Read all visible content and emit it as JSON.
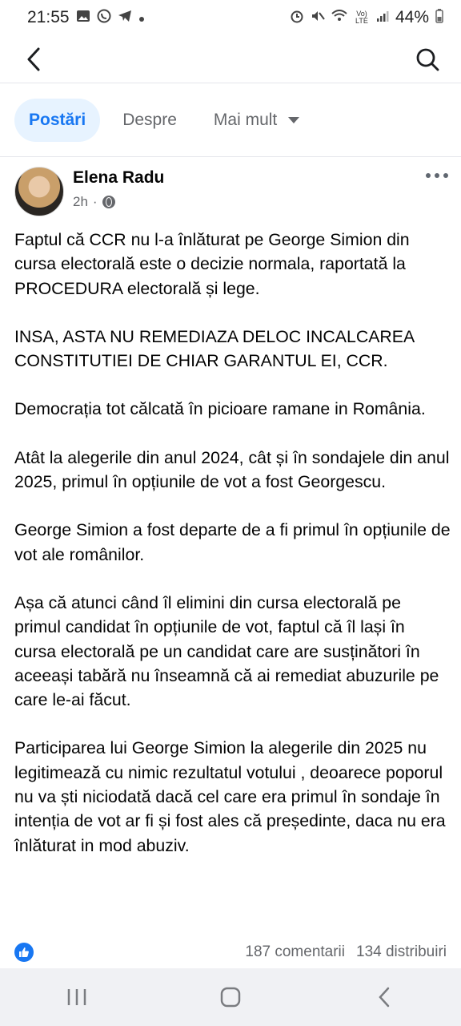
{
  "status_bar": {
    "time": "21:55",
    "battery": "44%",
    "network": "Vo) LTE"
  },
  "header": {
    "back_icon": "chevron-left-icon",
    "search_icon": "search-icon"
  },
  "tabs": [
    {
      "label": "Postări",
      "active": true
    },
    {
      "label": "Despre",
      "active": false
    },
    {
      "label": "Mai mult",
      "active": false
    }
  ],
  "post": {
    "author": "Elena Radu",
    "time": "2h",
    "separator": "·",
    "paragraphs": [
      "Faptul că CCR nu l-a înlăturat pe George Simion din cursa electorală este o decizie normala, raportată la PROCEDURA electorală și lege.",
      "INSA, ASTA NU REMEDIAZA DELOC INCALCAREA CONSTITUTIEI DE CHIAR GARANTUL EI, CCR.",
      "Democrația tot călcată în picioare ramane in România.",
      "Atât la alegerile din anul 2024, cât și în sondajele din anul 2025, primul în opțiunile de vot a fost Georgescu.",
      "George Simion a fost departe de a fi primul în opțiunile de vot ale românilor.",
      "Așa că atunci când îl elimini din cursa electorală pe primul candidat în opțiunile de vot, faptul că îl lași în cursa electorală pe un candidat care are susținători în aceeași tabără nu înseamnă că ai remediat abuzurile pe care le-ai făcut.",
      "Participarea lui George Simion la alegerile din 2025 nu legitimează cu nimic rezultatul votului , deoarece poporul nu va ști niciodată dacă cel care era primul în sondaje în intenția de vot ar fi și fost ales că președinte, daca nu era înlăturat in mod abuziv."
    ],
    "comments": "187 comentarii",
    "shares": "134 distribuiri"
  },
  "colors": {
    "accent": "#1877f2",
    "active_tab_bg": "#e7f3ff",
    "secondary_text": "#65676b"
  }
}
